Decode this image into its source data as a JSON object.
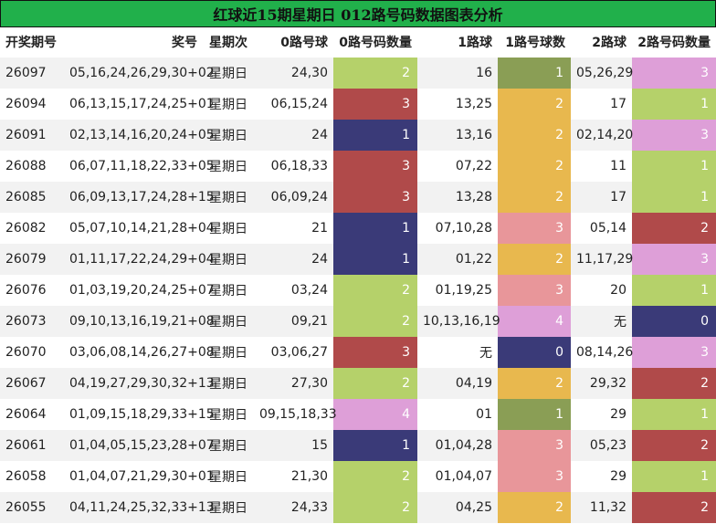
{
  "title": "红球近15期星期日 012路号码数据图表分析",
  "headers": [
    "开奖期号",
    "奖号",
    "星期次",
    "0路号球",
    "0路号码数量",
    "1路球",
    "1路号球数",
    "2路球",
    "2路号码数量"
  ],
  "colors": {
    "title_bg": "#21b04b",
    "count_0": "#3a3a78",
    "count_1": "#8a9e55",
    "count_2": "#b5d16a",
    "count_3": "#b04a4a",
    "count_4": "#de9fd8",
    "count_2_orange": "#e8b84e",
    "count_3_pink": "#e8969a"
  },
  "rows": [
    {
      "issue": "26097",
      "numbers": "05,16,24,26,29,30+02",
      "weekday": "星期日",
      "r0": "24,30",
      "c0": "2",
      "r1": "16",
      "c1": "1",
      "r2": "05,26,29",
      "c2": "3"
    },
    {
      "issue": "26094",
      "numbers": "06,13,15,17,24,25+01",
      "weekday": "星期日",
      "r0": "06,15,24",
      "c0": "3",
      "r1": "13,25",
      "c1": "2",
      "r2": "17",
      "c2": "1"
    },
    {
      "issue": "26091",
      "numbers": "02,13,14,16,20,24+05",
      "weekday": "星期日",
      "r0": "24",
      "c0": "1",
      "r1": "13,16",
      "c1": "2",
      "r2": "02,14,20",
      "c2": "3"
    },
    {
      "issue": "26088",
      "numbers": "06,07,11,18,22,33+05",
      "weekday": "星期日",
      "r0": "06,18,33",
      "c0": "3",
      "r1": "07,22",
      "c1": "2",
      "r2": "11",
      "c2": "1"
    },
    {
      "issue": "26085",
      "numbers": "06,09,13,17,24,28+15",
      "weekday": "星期日",
      "r0": "06,09,24",
      "c0": "3",
      "r1": "13,28",
      "c1": "2",
      "r2": "17",
      "c2": "1"
    },
    {
      "issue": "26082",
      "numbers": "05,07,10,14,21,28+04",
      "weekday": "星期日",
      "r0": "21",
      "c0": "1",
      "r1": "07,10,28",
      "c1": "3",
      "r2": "05,14",
      "c2": "2"
    },
    {
      "issue": "26079",
      "numbers": "01,11,17,22,24,29+04",
      "weekday": "星期日",
      "r0": "24",
      "c0": "1",
      "r1": "01,22",
      "c1": "2",
      "r2": "11,17,29",
      "c2": "3"
    },
    {
      "issue": "26076",
      "numbers": "01,03,19,20,24,25+07",
      "weekday": "星期日",
      "r0": "03,24",
      "c0": "2",
      "r1": "01,19,25",
      "c1": "3",
      "r2": "20",
      "c2": "1"
    },
    {
      "issue": "26073",
      "numbers": "09,10,13,16,19,21+08",
      "weekday": "星期日",
      "r0": "09,21",
      "c0": "2",
      "r1": "10,13,16,19",
      "c1": "4",
      "r2": "无",
      "c2": "0"
    },
    {
      "issue": "26070",
      "numbers": "03,06,08,14,26,27+08",
      "weekday": "星期日",
      "r0": "03,06,27",
      "c0": "3",
      "r1": "无",
      "c1": "0",
      "r2": "08,14,26",
      "c2": "3"
    },
    {
      "issue": "26067",
      "numbers": "04,19,27,29,30,32+13",
      "weekday": "星期日",
      "r0": "27,30",
      "c0": "2",
      "r1": "04,19",
      "c1": "2",
      "r2": "29,32",
      "c2": "2"
    },
    {
      "issue": "26064",
      "numbers": "01,09,15,18,29,33+15",
      "weekday": "星期日",
      "r0": "09,15,18,33",
      "c0": "4",
      "r1": "01",
      "c1": "1",
      "r2": "29",
      "c2": "1"
    },
    {
      "issue": "26061",
      "numbers": "01,04,05,15,23,28+07",
      "weekday": "星期日",
      "r0": "15",
      "c0": "1",
      "r1": "01,04,28",
      "c1": "3",
      "r2": "05,23",
      "c2": "2"
    },
    {
      "issue": "26058",
      "numbers": "01,04,07,21,29,30+01",
      "weekday": "星期日",
      "r0": "21,30",
      "c0": "2",
      "r1": "01,04,07",
      "c1": "3",
      "r2": "29",
      "c2": "1"
    },
    {
      "issue": "26055",
      "numbers": "04,11,24,25,32,33+13",
      "weekday": "星期日",
      "r0": "24,33",
      "c0": "2",
      "r1": "04,25",
      "c1": "2",
      "r2": "11,32",
      "c2": "2"
    }
  ]
}
